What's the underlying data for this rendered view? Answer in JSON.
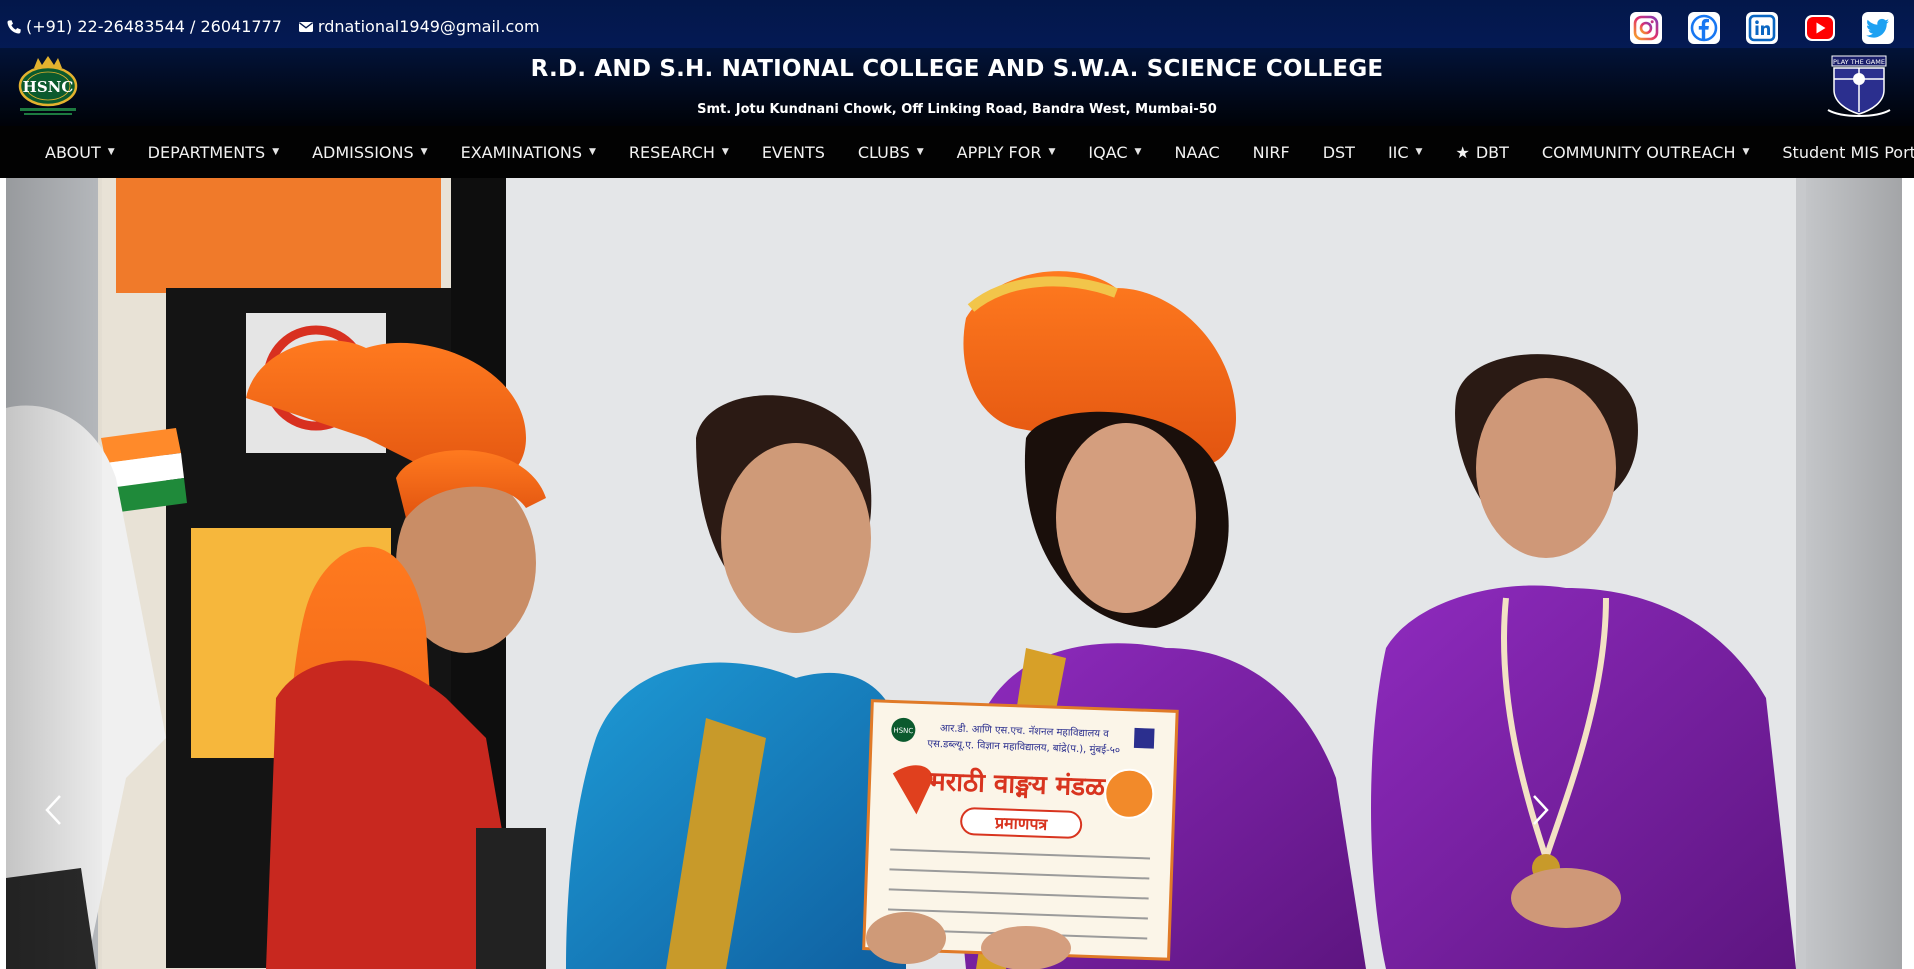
{
  "contact": {
    "phone": "(+91) 22-26483544 / 26041777",
    "email": "rdnational1949@gmail.com",
    "phone_icon": "phone-icon",
    "email_icon": "envelope-icon"
  },
  "socials": [
    {
      "name": "instagram",
      "icon": "instagram-icon",
      "color": "#c13584"
    },
    {
      "name": "facebook",
      "icon": "facebook-icon",
      "color": "#1877f2"
    },
    {
      "name": "linkedin",
      "icon": "linkedin-icon",
      "color": "#0a66c2"
    },
    {
      "name": "youtube",
      "icon": "youtube-icon",
      "color": "#ff0000"
    },
    {
      "name": "twitter",
      "icon": "twitter-icon",
      "color": "#1da1f2"
    }
  ],
  "header": {
    "logo_left_text": "HSNC",
    "title": "R.D. AND S.H. NATIONAL COLLEGE AND S.W.A. SCIENCE COLLEGE",
    "address": "Smt. Jotu Kundnani Chowk, Off Linking Road, Bandra West, Mumbai-50",
    "logo_right_text": "PLAY THE GAME"
  },
  "nav": {
    "home_icon": "home-icon",
    "items": [
      {
        "label": "ABOUT",
        "dropdown": true
      },
      {
        "label": "DEPARTMENTS",
        "dropdown": true
      },
      {
        "label": "ADMISSIONS",
        "dropdown": true
      },
      {
        "label": "EXAMINATIONS",
        "dropdown": true
      },
      {
        "label": "RESEARCH",
        "dropdown": true
      },
      {
        "label": "EVENTS",
        "dropdown": false
      },
      {
        "label": "CLUBS",
        "dropdown": true
      },
      {
        "label": "APPLY FOR",
        "dropdown": true
      },
      {
        "label": "IQAC",
        "dropdown": true
      },
      {
        "label": "NAAC",
        "dropdown": false
      },
      {
        "label": "NIRF",
        "dropdown": false
      },
      {
        "label": "DST",
        "dropdown": false
      },
      {
        "label": "IIC",
        "dropdown": true
      },
      {
        "label": "DBT",
        "dropdown": false,
        "icon": "star-icon"
      },
      {
        "label": "COMMUNITY OUTREACH",
        "dropdown": true
      },
      {
        "label": "Student MIS Portal",
        "dropdown": false
      }
    ]
  },
  "carousel": {
    "slide_description": "",
    "certificate": {
      "line1": "आर.डी. आणि एस.एच. नॅशनल महाविद्यालय व",
      "line2": "एस.डब्ल्यू.ए. विज्ञान महाविद्यालय, बांद्रे(प.), मुंबई-५०",
      "heading": "मराठी वाङ्मय मंडळ",
      "subheading": "प्रमाणपत्र",
      "logo": "HSNC"
    },
    "prev_icon": "chevron-left-icon",
    "next_icon": "chevron-right-icon"
  },
  "colors": {
    "topbar": "#03174a",
    "nav": "#020202",
    "saffron": "#f26a1b",
    "purple": "#7a1fa0"
  }
}
